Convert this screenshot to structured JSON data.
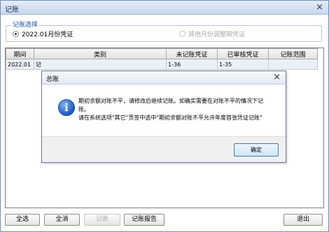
{
  "window": {
    "title": "记账",
    "close_glyph": "×"
  },
  "group": {
    "legend": "记账选择",
    "option_current": "2022.01月份凭证",
    "option_other": "其他月份调整期凭证"
  },
  "table": {
    "headers": [
      "期间",
      "类别",
      "未记账凭证",
      "已审核凭证",
      "记账范围"
    ],
    "rows": [
      [
        "2022.01",
        "记",
        "1-36",
        "1-35",
        ""
      ]
    ]
  },
  "buttons": {
    "select_all": "全选",
    "clear_all": "全消",
    "post": "记账",
    "report": "记账报告",
    "exit": "退出"
  },
  "dialog": {
    "title": "总账",
    "close_glyph": "×",
    "icon": "info-icon",
    "message_line1": "期初余额对账不平，请修改后继续记账。如确实需要在对账不平的情况下记",
    "message_line2": "账。",
    "message_line3": "请在系统选项\"其它\"页签中选中\"期初余额对账不平允许年度首张凭证记账\"",
    "ok_label": "确定"
  }
}
